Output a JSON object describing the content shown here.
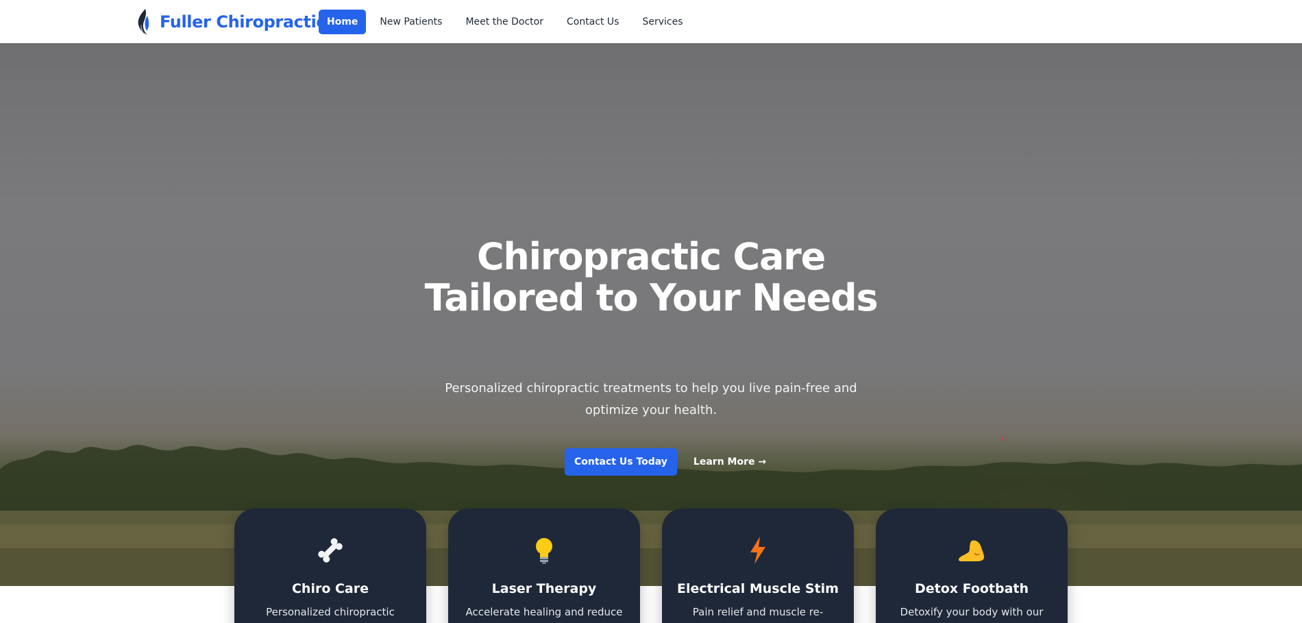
{
  "brand": {
    "name": "Fuller Chiropractic",
    "logo_icon": "flame-logo-icon"
  },
  "nav": {
    "items": [
      {
        "label": "Home",
        "active": true
      },
      {
        "label": "New Patients",
        "active": false
      },
      {
        "label": "Meet the Doctor",
        "active": false
      },
      {
        "label": "Contact Us",
        "active": false
      },
      {
        "label": "Services",
        "active": false
      }
    ]
  },
  "hero": {
    "title_line1": "Chiropractic Care",
    "title_line2": "Tailored to Your Needs",
    "subtitle": "Personalized chiropractic treatments to help you live pain-free and optimize your health.",
    "primary_button": "Contact Us Today",
    "secondary_link": "Learn More →"
  },
  "services": [
    {
      "icon": "bone-icon",
      "title": "Chiro Care",
      "description": "Personalized chiropractic"
    },
    {
      "icon": "lightbulb-icon",
      "title": "Laser Therapy",
      "description": "Accelerate healing and reduce"
    },
    {
      "icon": "lightning-icon",
      "title": "Electrical Muscle Stim",
      "description": "Pain relief and muscle re-"
    },
    {
      "icon": "foot-icon",
      "title": "Detox Footbath",
      "description": "Detoxify your body with our"
    }
  ],
  "colors": {
    "accent": "#2563eb",
    "card_bg": "#1e2839",
    "bolt": "#f97316",
    "bulb": "#facc15"
  }
}
